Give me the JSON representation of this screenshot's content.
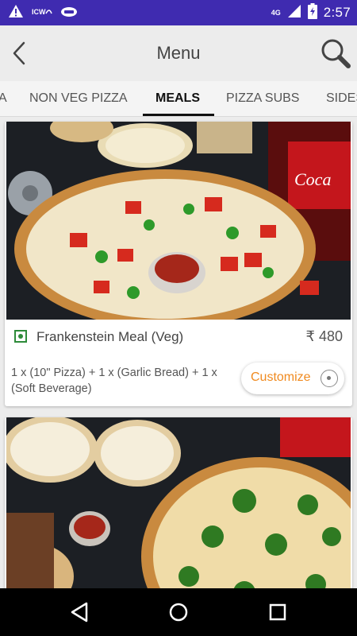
{
  "status_bar": {
    "time": "2:57",
    "network": "4G",
    "icons": [
      "warning-icon",
      "hd-voice-icon",
      "cloud-icon",
      "signal-icon",
      "battery-charging-icon"
    ]
  },
  "header": {
    "title": "Menu",
    "back_icon": "chevron-left-icon",
    "search_icon": "search-icon"
  },
  "tabs": [
    {
      "label": "A",
      "active": false
    },
    {
      "label": "NON VEG PIZZA",
      "active": false
    },
    {
      "label": "MEALS",
      "active": true
    },
    {
      "label": "PIZZA SUBS",
      "active": false
    },
    {
      "label": "SIDES",
      "active": false
    }
  ],
  "items": [
    {
      "name": "Frankenstein Meal (Veg)",
      "price": "₹ 480",
      "description": "1 x (10\" Pizza) + 1 x (Garlic Bread) + 1 x (Soft Beverage)",
      "button_label": "Customize",
      "veg": true
    }
  ],
  "colors": {
    "status_bar": "#3f2bb0",
    "accent": "#f08a1f",
    "veg": "#2e8b3a"
  },
  "nav": {
    "back": "back-triangle-icon",
    "home": "home-circle-icon",
    "recents": "recents-square-icon"
  }
}
